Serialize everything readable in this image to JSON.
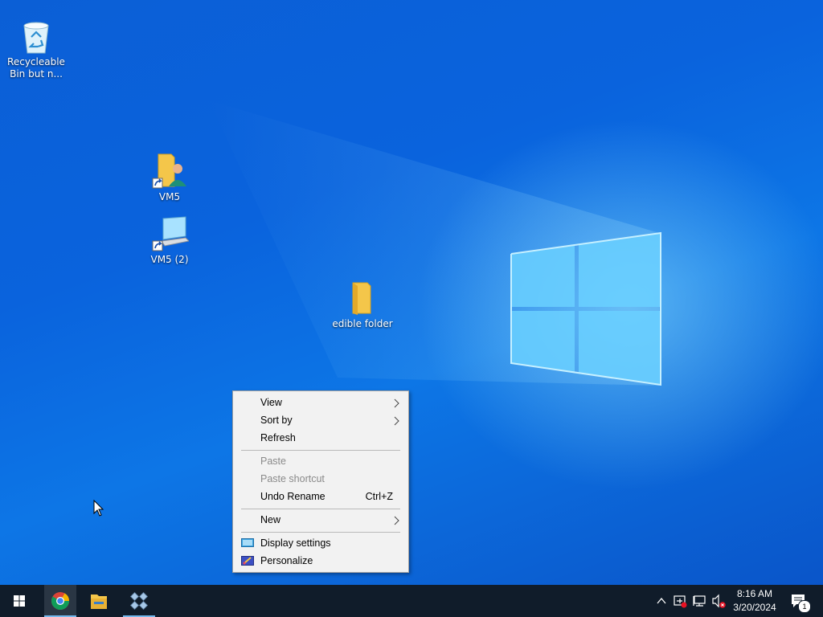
{
  "desktop": {
    "icons": [
      {
        "label": "Recycleable\nBin but n...",
        "icon": "recycle-bin-icon"
      },
      {
        "label": "VM5",
        "icon": "user-folder-shortcut-icon"
      },
      {
        "label": "VM5 (2)",
        "icon": "computer-shortcut-icon"
      },
      {
        "label": "edible folder",
        "icon": "folder-icon"
      }
    ]
  },
  "context_menu": {
    "view": "View",
    "sort_by": "Sort by",
    "refresh": "Refresh",
    "paste": "Paste",
    "paste_shortcut": "Paste shortcut",
    "undo_rename": "Undo Rename",
    "undo_shortcut": "Ctrl+Z",
    "new": "New",
    "display_settings": "Display settings",
    "personalize": "Personalize"
  },
  "taskbar": {
    "apps": [
      "start-icon",
      "chrome-icon",
      "file-explorer-icon",
      "app-icon"
    ],
    "clock": {
      "time": "8:16 AM",
      "date": "3/20/2024"
    },
    "notification_count": "1"
  },
  "colors": {
    "taskbar": "#101c2a",
    "menu": "#f2f2f2",
    "desktop": "#0a63dd"
  }
}
